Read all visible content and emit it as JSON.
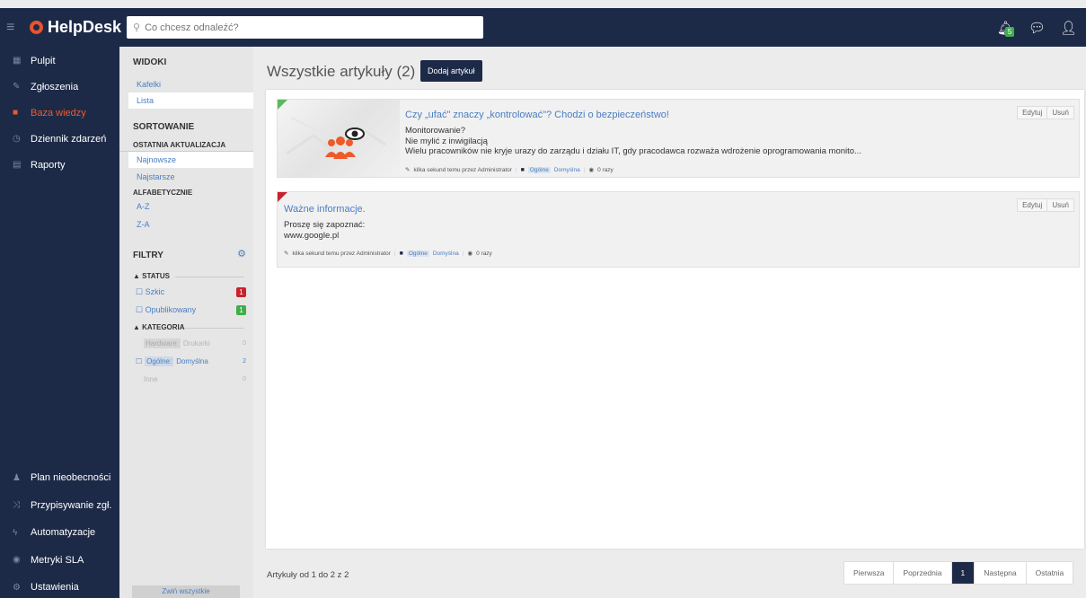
{
  "app": {
    "name": "HelpDesk"
  },
  "search": {
    "placeholder": "Co chcesz odnaleźć?"
  },
  "topbar": {
    "notifications_count": "5"
  },
  "nav": {
    "items": [
      {
        "label": "Pulpit",
        "icon": "grid-icon"
      },
      {
        "label": "Zgłoszenia",
        "icon": "ticket-icon"
      },
      {
        "label": "Baza wiedzy",
        "icon": "book-icon",
        "active": true
      },
      {
        "label": "Dziennik zdarzeń",
        "icon": "clock-icon"
      },
      {
        "label": "Raporty",
        "icon": "report-icon"
      }
    ],
    "bottom": [
      {
        "label": "Plan nieobecności",
        "icon": "users-icon"
      },
      {
        "label": "Przypisywanie zgł.",
        "icon": "shuffle-icon"
      },
      {
        "label": "Automatyzacje",
        "icon": "bolt-icon"
      },
      {
        "label": "Metryki SLA",
        "icon": "eye-icon"
      },
      {
        "label": "Ustawienia",
        "icon": "gears-icon"
      }
    ]
  },
  "panel": {
    "views_heading": "WIDOKI",
    "views": [
      "Kafelki",
      "Lista"
    ],
    "sort_heading": "SORTOWANIE",
    "sort_last_update": "OSTATNIA AKTUALIZACJA",
    "sort_newest": "Najnowsze",
    "sort_oldest": "Najstarsze",
    "sort_alpha": "ALFABETYCZNIE",
    "sort_az": "A-Z",
    "sort_za": "Z-A",
    "filters_heading": "FILTRY",
    "status_heading": "▲ STATUS",
    "status": [
      {
        "label": "☐ Szkic",
        "count": "1",
        "color": "#c8232c"
      },
      {
        "label": "☐ Opublikowany",
        "count": "1",
        "color": "#3fae49"
      }
    ],
    "category_heading": "▲ KATEGORIA",
    "categories": [
      {
        "tag": "Hardware:",
        "label": "Drukarki",
        "count": "0"
      },
      {
        "prefix": "☐",
        "tag": "Ogólne:",
        "label": "Domyślna",
        "count": "2"
      },
      {
        "tag": "",
        "label": "Inne",
        "count": "0"
      }
    ],
    "collapse_all": "Zwiń wszystkie"
  },
  "main": {
    "title": "Wszystkie artykuły (2)",
    "add_button": "Dodaj artykuł",
    "articles": [
      {
        "title": "Czy „ufać\" znaczy „kontrolować\"? Chodzi o bezpieczeństwo!",
        "lines": [
          "Monitorowanie?",
          "Nie mylić z inwigilacją",
          "Wielu pracowników nie kryje urazy do zarządu i działu IT, gdy pracodawca rozważa wdrożenie oprogramowania monito..."
        ],
        "meta_author": "kilka sekund temu przez Administrator",
        "meta_tag": "Ogólne",
        "meta_cat": "Domyślna",
        "meta_views": "0 razy",
        "edit": "Edytuj",
        "delete": "Usuń",
        "status_color": "#5cb85c"
      },
      {
        "title": "Ważne informacje.",
        "lines": [
          "Proszę się zapoznać:",
          "www.google.pl"
        ],
        "meta_author": "kilka sekund temu przez Administrator",
        "meta_tag": "Ogólne",
        "meta_cat": "Domyślna",
        "meta_views": "0 razy",
        "edit": "Edytuj",
        "delete": "Usuń",
        "status_color": "#c8232c"
      }
    ],
    "count_text": "Artykuły od 1 do 2 z 2",
    "pager": [
      "Pierwsza",
      "Poprzednia",
      "1",
      "Następna",
      "Ostatnia"
    ]
  }
}
